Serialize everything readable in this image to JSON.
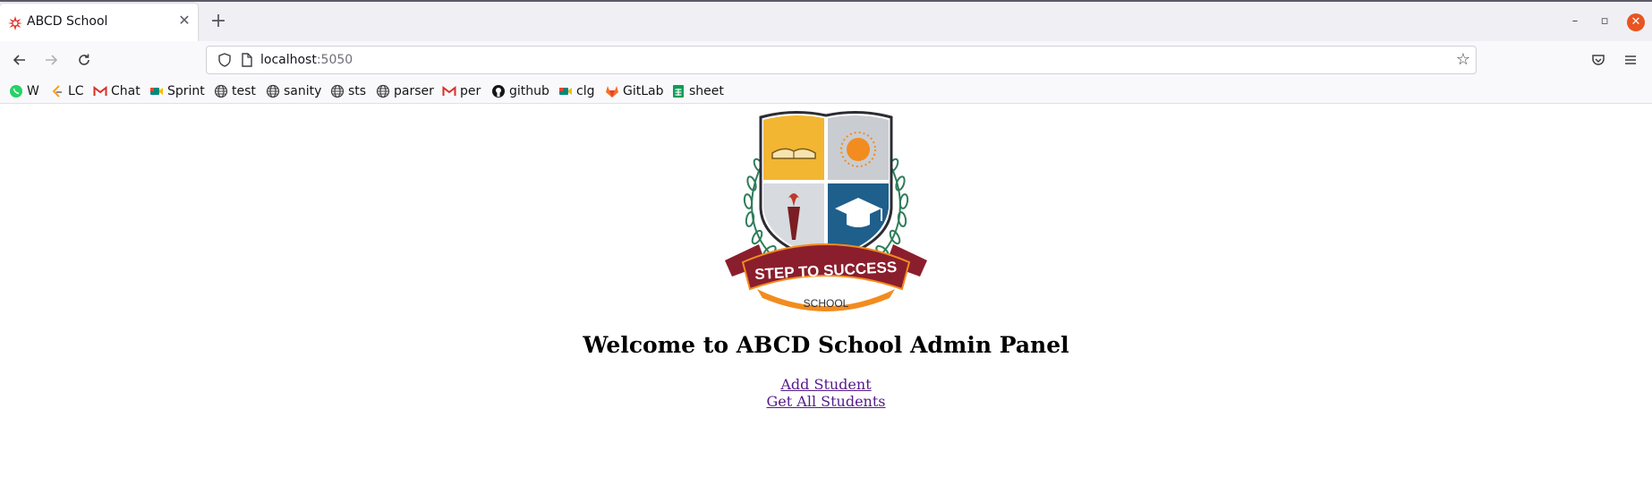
{
  "browser": {
    "tab": {
      "title": "ABCD School",
      "favicon": "star-burst-icon"
    },
    "new_tab_label": "+",
    "window_controls": {
      "minimize": "–",
      "restore": "▫",
      "close": "✕"
    },
    "address": {
      "host": "localhost",
      "port": ":5050"
    },
    "bookmarks": [
      {
        "label": "W",
        "icon": "whatsapp-icon",
        "color": "#25d366"
      },
      {
        "label": "LC",
        "icon": "leetcode-icon",
        "color": "#f89f1b"
      },
      {
        "label": "Chat",
        "icon": "gmail-icon",
        "color": "#d93025"
      },
      {
        "label": "Sprint",
        "icon": "meet-icon",
        "color": "#00897b"
      },
      {
        "label": "test",
        "icon": "globe-icon",
        "color": "#3d3d44"
      },
      {
        "label": "sanity",
        "icon": "globe-icon",
        "color": "#3d3d44"
      },
      {
        "label": "sts",
        "icon": "globe-icon",
        "color": "#3d3d44"
      },
      {
        "label": "parser",
        "icon": "globe-icon",
        "color": "#3d3d44"
      },
      {
        "label": "per",
        "icon": "gmail-icon",
        "color": "#d93025"
      },
      {
        "label": "github",
        "icon": "github-icon",
        "color": "#15141a"
      },
      {
        "label": "clg",
        "icon": "meet-icon",
        "color": "#00897b"
      },
      {
        "label": "GitLab",
        "icon": "gitlab-icon",
        "color": "#fc6d26"
      },
      {
        "label": "sheet",
        "icon": "sheets-icon",
        "color": "#0f9d58"
      }
    ]
  },
  "page": {
    "logo": {
      "banner_text": "STEP TO SUCCESS",
      "sub_text": "SCHOOL"
    },
    "title": "Welcome to ABCD School Admin Panel",
    "links": [
      {
        "label": "Add Student"
      },
      {
        "label": "Get All Students"
      }
    ]
  },
  "colors": {
    "link": "#551a8b",
    "shield_gold": "#f2b632",
    "shield_blue": "#1f5f8b",
    "banner_red": "#8b1e2d",
    "laurel_green": "#2e7d5b"
  }
}
